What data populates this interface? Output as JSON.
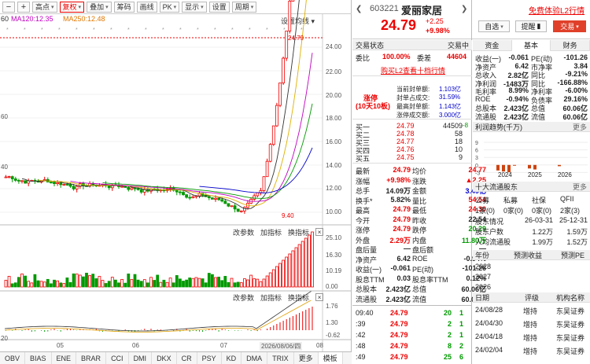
{
  "toolbar": {
    "items": [
      "高点",
      "复权",
      "叠加",
      "筹码",
      "画线",
      "PK",
      "显示",
      "设置",
      "周期"
    ],
    "more": "设置均线"
  },
  "ma": [
    {
      "label": "MA120:12.35",
      "color": "#c000c0"
    },
    {
      "label": "MA250:12.48",
      "color": "#e07800"
    }
  ],
  "ma_prefix": "60",
  "price_axis": [
    "24.00",
    "22.00",
    "20.00",
    "18.00",
    "16.00",
    "14.00",
    "12.00",
    "10.00"
  ],
  "high_mark": "24.79",
  "low_mark": "9.40",
  "vol_axis": [
    "25.10",
    "16.30",
    "10.19",
    "0.00"
  ],
  "macd_axis": [
    "1.76",
    "1.30",
    "-0.62"
  ],
  "sub_bar1": {
    "a": "改参数",
    "b": "加指标",
    "c": "换指标",
    "x": "×"
  },
  "sub_bar2": {
    "a": "改参数",
    "b": "加指标",
    "c": "换指标",
    "x": "×"
  },
  "x_labels": [
    "05",
    "06",
    "07",
    "08"
  ],
  "date_tag": "2026/08/06/四",
  "left_axis": [
    "60",
    "40",
    "20"
  ],
  "bottom_tabs": [
    "OBV",
    "BIAS",
    "ENE",
    "BRAR",
    "CCI",
    "DMI",
    "DKX",
    "CR",
    "PSY",
    "KD",
    "DMA",
    "TRIX",
    "更多",
    "模板"
  ],
  "header": {
    "code": "603221",
    "name": "爱丽家居",
    "price": "24.79",
    "chg": "+2.25",
    "pct": "+9.98%",
    "free": "免费体验L2行情",
    "zixuan": "自选",
    "tixing": "提醒",
    "jiaoyi": "交易"
  },
  "trade": {
    "status_label": "交易状态",
    "status": "交易中",
    "weibi_label": "委比",
    "weibi": "100.00%",
    "weicha_label": "委差",
    "weicha": "44604",
    "link": "购买L2查看十档行情",
    "zt_label": "涨停",
    "zt_sub": "(10天10板)",
    "stats": [
      {
        "k": "当前封单额:",
        "v": "1.103亿"
      },
      {
        "k": "封单占成交:",
        "v": "31.59%"
      },
      {
        "k": "最高封单额:",
        "v": "1.143亿"
      },
      {
        "k": "涨停成交额:",
        "v": "3.000亿"
      }
    ],
    "buys": [
      {
        "n": "买一",
        "p": "24.79",
        "v": "44509",
        "d": "-8"
      },
      {
        "n": "买二",
        "p": "24.78",
        "v": "58",
        "d": ""
      },
      {
        "n": "买三",
        "p": "24.77",
        "v": "18",
        "d": ""
      },
      {
        "n": "买四",
        "p": "24.76",
        "v": "10",
        "d": ""
      },
      {
        "n": "买五",
        "p": "24.75",
        "v": "9",
        "d": ""
      }
    ],
    "quotes": [
      [
        {
          "k": "最新",
          "v": "24.79",
          "c": "red"
        },
        {
          "k": "均价",
          "v": "24.77",
          "c": "red"
        }
      ],
      [
        {
          "k": "涨幅",
          "v": "+9.98%",
          "c": "red"
        },
        {
          "k": "涨跌",
          "v": "▲2.25",
          "c": "red"
        }
      ],
      [
        {
          "k": "总手",
          "v": "14.09万",
          "c": ""
        },
        {
          "k": "金额",
          "v": "3.49亿",
          "c": "blu"
        }
      ],
      [
        {
          "k": "换手*",
          "v": "5.82%",
          "c": ""
        },
        {
          "k": "量比",
          "v": "54.54",
          "c": "red"
        }
      ],
      [
        {
          "k": "最高",
          "v": "24.79",
          "c": "red"
        },
        {
          "k": "最低",
          "v": "24.30",
          "c": "red"
        }
      ],
      [
        {
          "k": "今开",
          "v": "24.79",
          "c": "red"
        },
        {
          "k": "昨收",
          "v": "22.54",
          "c": ""
        }
      ],
      [
        {
          "k": "涨停",
          "v": "24.79",
          "c": "red"
        },
        {
          "k": "跌停",
          "v": "20.29",
          "c": "grn"
        }
      ],
      [
        {
          "k": "外盘",
          "v": "2.29万",
          "c": "red"
        },
        {
          "k": "内盘",
          "v": "11.80万",
          "c": "grn"
        }
      ],
      [
        {
          "k": "盘后量",
          "v": "—",
          "c": ""
        },
        {
          "k": "盘后额",
          "v": "—",
          "c": ""
        }
      ],
      [
        {
          "k": "净资产",
          "v": "6.42",
          "c": ""
        },
        {
          "k": "ROE",
          "v": "-0.94%",
          "c": ""
        }
      ],
      [
        {
          "k": "收益(一)",
          "v": "-0.061",
          "c": ""
        },
        {
          "k": "PE(动)",
          "v": "-101.26",
          "c": ""
        }
      ],
      [
        {
          "k": "股息TTM",
          "v": "0.03",
          "c": ""
        },
        {
          "k": "股息率TTM",
          "v": "0.12%",
          "c": ""
        }
      ],
      [
        {
          "k": "总股本",
          "v": "2.423亿",
          "c": ""
        },
        {
          "k": "总值",
          "v": "60.06亿",
          "c": ""
        }
      ],
      [
        {
          "k": "流通股",
          "v": "2.423亿",
          "c": ""
        },
        {
          "k": "流值",
          "v": "60.06亿",
          "c": ""
        }
      ]
    ],
    "ticks": [
      {
        "t": "09:40",
        "p": "24.79",
        "v": "20",
        "d": "1"
      },
      {
        "t": ":39",
        "p": "24.79",
        "v": "2",
        "d": "1"
      },
      {
        "t": ":42",
        "p": "24.79",
        "v": "2",
        "d": "1"
      },
      {
        "t": ":48",
        "p": "24.79",
        "v": "8",
        "d": "2"
      },
      {
        "t": ":49",
        "p": "24.79",
        "v": "25",
        "d": "6"
      }
    ]
  },
  "fin": {
    "tabs": [
      "资金",
      "基本",
      "财务"
    ],
    "rows": [
      [
        {
          "k": "收益(一)",
          "v": "-0.061"
        },
        {
          "k": "PE(动)",
          "v": "-101.26"
        }
      ],
      [
        {
          "k": "净资产",
          "v": "6.42"
        },
        {
          "k": "市净率",
          "v": "3.84"
        }
      ],
      [
        {
          "k": "总收入",
          "v": "2.82亿"
        },
        {
          "k": "同比",
          "v": "-9.21%"
        }
      ],
      [
        {
          "k": "净利润",
          "v": "-1483万"
        },
        {
          "k": "同比",
          "v": "-166.88%"
        }
      ],
      [
        {
          "k": "毛利率",
          "v": "8.99%"
        },
        {
          "k": "净利率",
          "v": "-6.00%"
        }
      ],
      [
        {
          "k": "ROE",
          "v": "-0.94%"
        },
        {
          "k": "负债率",
          "v": "29.16%"
        }
      ],
      [
        {
          "k": "总股本",
          "v": "2.423亿"
        },
        {
          "k": "总值",
          "v": "60.06亿"
        }
      ],
      [
        {
          "k": "流通股",
          "v": "2.423亿"
        },
        {
          "k": "流值",
          "v": "60.06亿"
        }
      ]
    ],
    "profit_title": "利润趋势(千万)",
    "more": "更多",
    "profit_axis": [
      "9",
      "6",
      "3",
      "0",
      "-3"
    ],
    "profit_years": [
      "2024",
      "2025",
      "2026"
    ],
    "top10_title": "十大流通股东",
    "top10_headers": [
      "公募",
      "私募",
      "社保",
      "QFII"
    ],
    "top10_vals": [
      "1家(0)",
      "0家(0)",
      "0家(0)",
      "2家(3)"
    ],
    "holders": [
      {
        "k": "股东情况",
        "a": "26-03-31",
        "b": "25-12-31"
      },
      {
        "k": "股东户数",
        "a": "1.22万",
        "b": "1.59万"
      },
      {
        "k": "人均流通股",
        "a": "1.99万",
        "b": "1.52万"
      }
    ],
    "forecast_headers": [
      "年份",
      "预测收益",
      "预测PE"
    ],
    "years": [
      "2028",
      "2027",
      "2026"
    ],
    "rating_headers": [
      "日期",
      "评级",
      "机构名称"
    ],
    "ratings": [
      {
        "d": "24/08/28",
        "r": "增持",
        "o": "东吴证券"
      },
      {
        "d": "24/04/30",
        "r": "增持",
        "o": "东吴证券"
      },
      {
        "d": "24/04/18",
        "r": "增持",
        "o": "东吴证券"
      },
      {
        "d": "24/02/04",
        "r": "增持",
        "o": "东吴证券"
      }
    ]
  },
  "chart_data": {
    "type": "candlestick",
    "profit_bars": [
      {
        "year": "2024",
        "values": [
          -2.2,
          -2.6,
          -2.9,
          -0.3
        ]
      },
      {
        "year": "2025",
        "values": [
          -1.4,
          -1.8
        ]
      },
      {
        "year": "2026",
        "values": [
          -0.5
        ]
      }
    ]
  }
}
